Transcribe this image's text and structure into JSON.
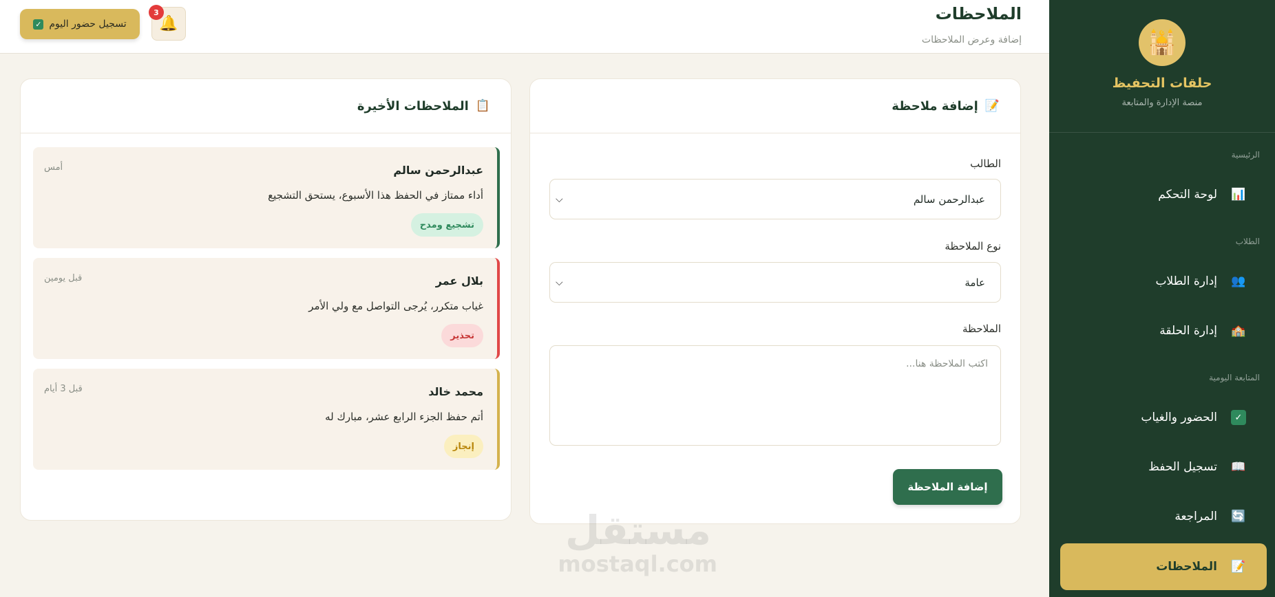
{
  "sidebar": {
    "brand_title": "حلقات التحفيظ",
    "brand_subtitle": "منصة الإدارة والمتابعة",
    "sections": {
      "main": "الرئيسية",
      "students": "الطلاب",
      "daily": "المتابعة اليومية"
    },
    "items": [
      {
        "label": "لوحة التحكم",
        "icon": "chart-icon",
        "glyph": "📊"
      },
      {
        "label": "إدارة الطلاب",
        "icon": "users-icon",
        "glyph": "👥"
      },
      {
        "label": "إدارة الحلقة",
        "icon": "school-icon",
        "glyph": "🏫"
      },
      {
        "label": "الحضور والغياب",
        "icon": "checkbox-icon",
        "glyph": "✓"
      },
      {
        "label": "تسجيل الحفظ",
        "icon": "book-icon",
        "glyph": "📖"
      },
      {
        "label": "المراجعة",
        "icon": "refresh-icon",
        "glyph": "🔄"
      },
      {
        "label": "الملاحظات",
        "icon": "memo-icon",
        "glyph": "📝",
        "active": true
      }
    ]
  },
  "header": {
    "title": "الملاحظات",
    "subtitle": "إضافة وعرض الملاحظات",
    "attendance_button": "تسجيل حضور اليوم",
    "notification_count": "3"
  },
  "form": {
    "title": "إضافة ملاحظة",
    "student_label": "الطالب",
    "student_value": "عبدالرحمن سالم",
    "type_label": "نوع الملاحظة",
    "type_value": "عامة",
    "note_label": "الملاحظة",
    "note_placeholder": "اكتب الملاحظة هنا...",
    "submit": "إضافة الملاحظة"
  },
  "recent": {
    "title": "الملاحظات الأخيرة",
    "notes": [
      {
        "name": "عبدالرحمن سالم",
        "time": "أمس",
        "text": "أداء ممتاز في الحفظ هذا الأسبوع، يستحق التشجيع",
        "tag": "تشجيع ومدح",
        "color": "#2f6e4d",
        "tag_bg": "#d5f1e1",
        "tag_fg": "#2f8a5d"
      },
      {
        "name": "بلال عمر",
        "time": "قبل يومين",
        "text": "غياب متكرر، يُرجى التواصل مع ولي الأمر",
        "tag": "تحذير",
        "color": "#e04848",
        "tag_bg": "#fbdada",
        "tag_fg": "#c73838"
      },
      {
        "name": "محمد خالد",
        "time": "قبل 3 أيام",
        "text": "أتم حفظ الجزء الرابع عشر، مبارك له",
        "tag": "إنجاز",
        "color": "#d4b24e",
        "tag_bg": "#fbefbf",
        "tag_fg": "#b8860b"
      }
    ]
  },
  "watermark": {
    "arabic": "مستقل",
    "latin": "mostaql.com"
  }
}
